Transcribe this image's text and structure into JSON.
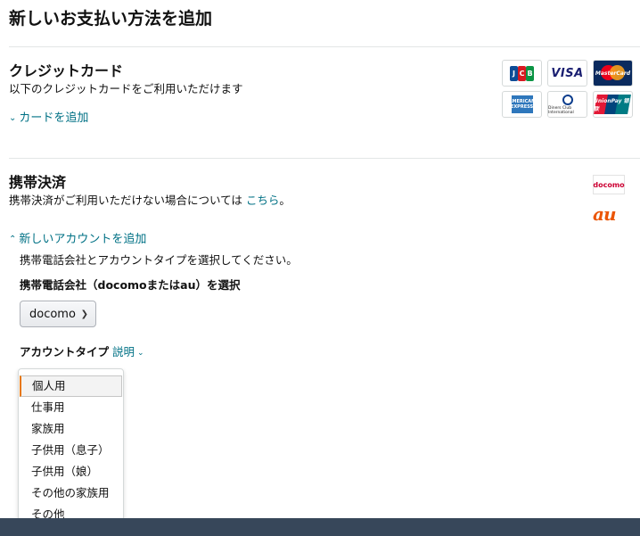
{
  "page": {
    "title": "新しいお支払い方法を追加"
  },
  "credit_card": {
    "title": "クレジットカード",
    "description": "以下のクレジットカードをご利用いただけます",
    "add_card_link": "カードを追加",
    "logos": {
      "jcb": "JCB",
      "visa": "VISA",
      "mastercard": "MasterCard",
      "amex": "AMERICAN EXPRESS",
      "diners": "Diners Club International",
      "unionpay": "UnionPay 银联"
    }
  },
  "carrier_billing": {
    "title": "携帯決済",
    "description_prefix": "携帯決済がご利用いただけない場合については",
    "description_link": "こちら",
    "description_suffix": "。",
    "add_account_link": "新しいアカウントを追加",
    "instructions": "携帯電話会社とアカウントタイプを選択してください。",
    "carrier_label": "携帯電話会社（docomoまたはau）を選択",
    "carrier_selected": "docomo",
    "account_type_label": "アカウントタイプ",
    "account_type_help": "説明",
    "account_type_options": [
      "個人用",
      "仕事用",
      "家族用",
      "子供用（息子）",
      "子供用（娘）",
      "その他の家族用",
      "その他"
    ],
    "account_type_highlighted": "個人用",
    "docomo_logo": "docomo",
    "au_logo": "au"
  },
  "colors": {
    "link": "#007185",
    "footer": "#37475a",
    "focus": "#e77600"
  }
}
